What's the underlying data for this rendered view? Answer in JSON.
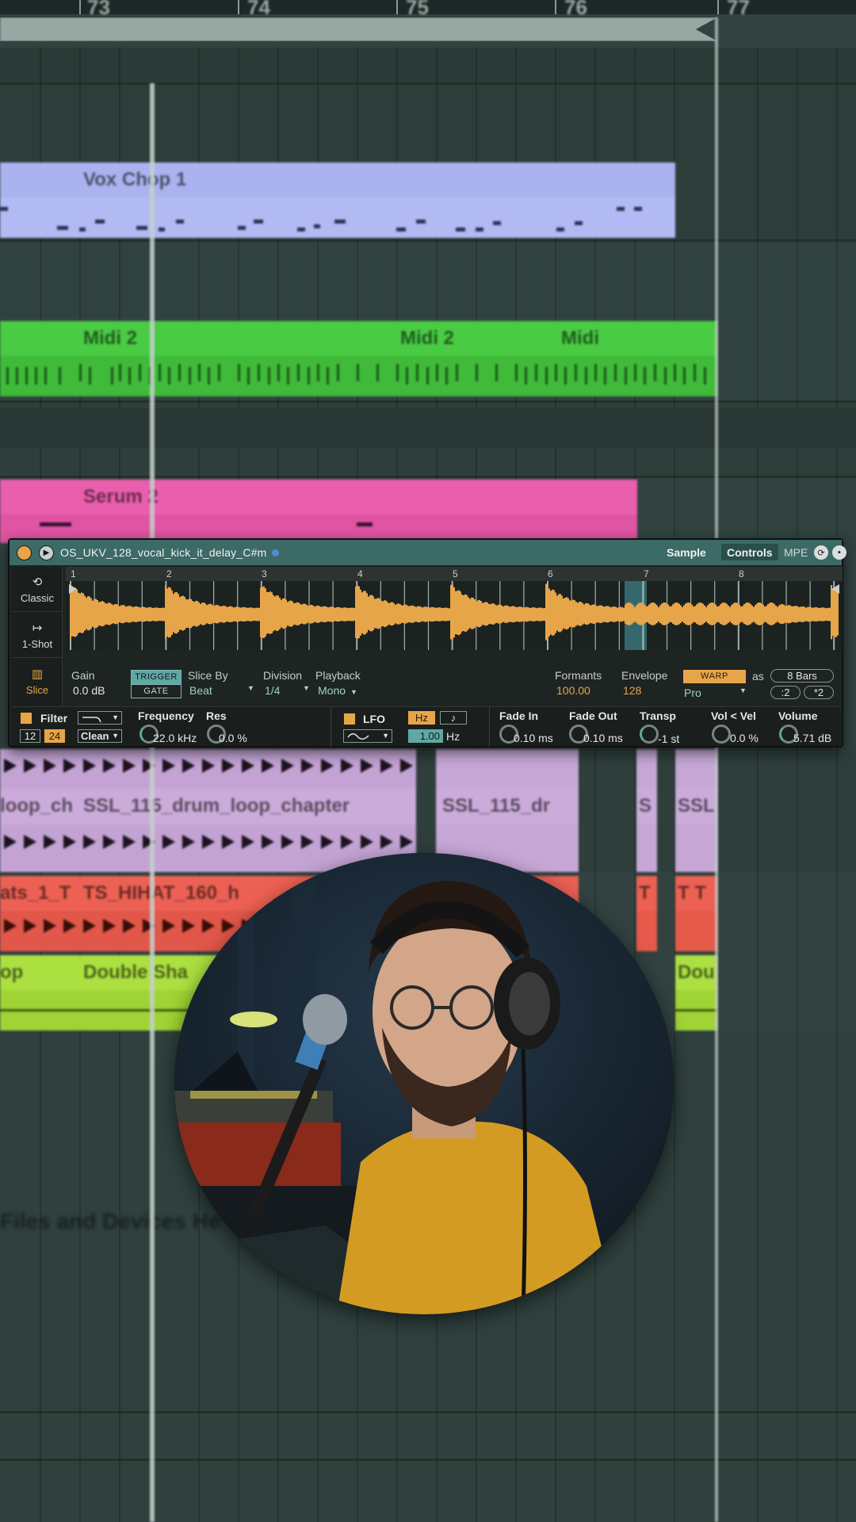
{
  "arrangement": {
    "ruler_bars": [
      "73",
      "74",
      "75",
      "76",
      "77"
    ],
    "clips": {
      "vox": "Vox Chop 1",
      "midi_a": "Midi 2",
      "midi_b": "Midi 2",
      "midi_c": "Midi",
      "serum": "Serum 2",
      "loop_a": "loop_ch",
      "loop_b": "SSL_115_drum_loop_chapter",
      "loop_c": "SSL_115_dr",
      "loop_d": "S",
      "loop_e": "SSL",
      "hat_a": "ats_1_T",
      "hat_b": "TS_HIHAT_160_h",
      "hat_c": "T",
      "hat_d": "T T",
      "shaker_a": "op",
      "shaker_b": "Double Sha",
      "shaker_c": "Dou"
    },
    "footer_text": "Files and Devices He"
  },
  "simpler": {
    "title": "OS_UKV_128_vocal_kick_it_delay_C#m",
    "tabs": {
      "sample": "Sample",
      "controls": "Controls",
      "mpe": "MPE"
    },
    "modes": {
      "classic": "Classic",
      "oneshot": "1-Shot",
      "slice": "Slice"
    },
    "waveform_markers": [
      "1",
      "2",
      "3",
      "4",
      "5",
      "6",
      "7",
      "8"
    ],
    "gain": {
      "label": "Gain",
      "value": "0.0 dB"
    },
    "trigger": {
      "on": "TRIGGER",
      "off": "GATE"
    },
    "slice_by": {
      "label": "Slice By",
      "value": "Beat"
    },
    "division": {
      "label": "Division",
      "value": "1/4"
    },
    "playback": {
      "label": "Playback",
      "value": "Mono"
    },
    "formants": {
      "label": "Formants",
      "value": "100.00"
    },
    "envelope": {
      "label": "Envelope",
      "value": "128"
    },
    "warp": {
      "label": "WARP",
      "mode": "Pro",
      "as": "as",
      "length": "8 Bars",
      "half": ":2",
      "double": "*2"
    },
    "filter": {
      "label": "Filter",
      "slope_12": "12",
      "slope_24": "24",
      "type": "Clean"
    },
    "frequency": {
      "label": "Frequency",
      "value": "22.0 kHz"
    },
    "res": {
      "label": "Res",
      "value": "0.0 %"
    },
    "lfo": {
      "label": "LFO",
      "hz": "Hz",
      "note": "♪",
      "rate": "1.00",
      "unit": "Hz"
    },
    "fade_in": {
      "label": "Fade In",
      "value": "0.10 ms"
    },
    "fade_out": {
      "label": "Fade Out",
      "value": "0.10 ms"
    },
    "transp": {
      "label": "Transp",
      "value": "-1 st"
    },
    "vol_vel": {
      "label": "Vol < Vel",
      "value": "0.0 %"
    },
    "volume": {
      "label": "Volume",
      "value": "5.71 dB"
    },
    "colors": {
      "accent": "#e7a54a",
      "teal": "#5fa8a3",
      "title_bar": "#3c6a66"
    }
  }
}
